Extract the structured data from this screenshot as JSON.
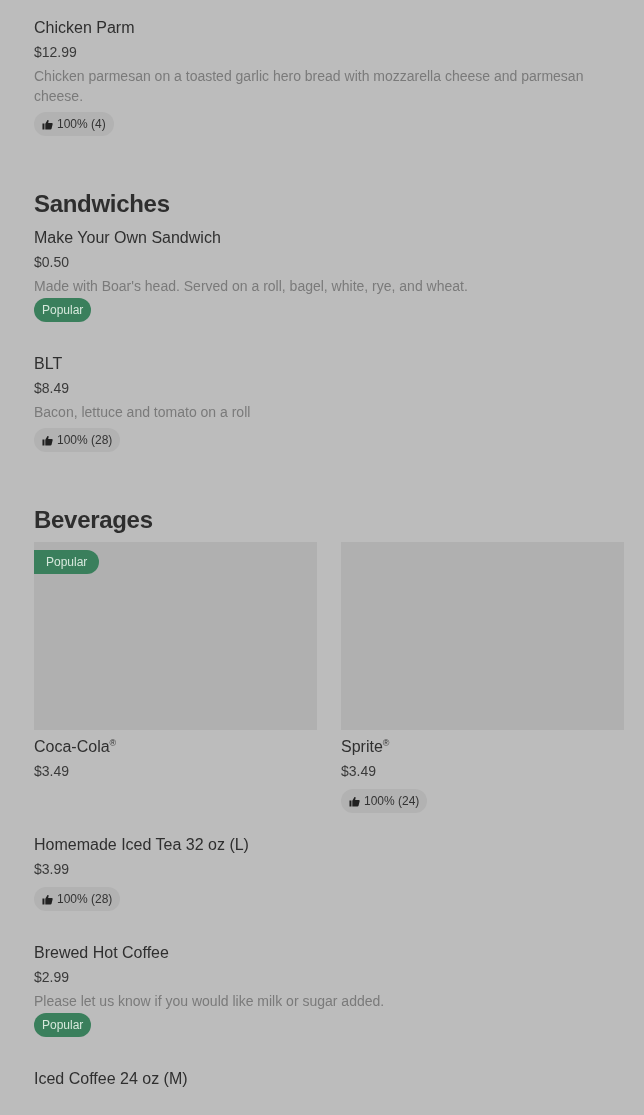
{
  "sections": [
    {
      "items": [
        {
          "name": "Chicken Parm",
          "price": "$12.99",
          "description": "Chicken parmesan on a toasted garlic hero bread with mozzarella cheese and parmesan cheese.",
          "badge": {
            "kind": "rating",
            "text": "100% (4)"
          }
        }
      ]
    },
    {
      "heading": "Sandwiches",
      "items": [
        {
          "name": "Make Your Own Sandwich",
          "price": "$0.50",
          "description": "Made with Boar's head. Served on a roll, bagel, white, rye, and wheat.",
          "badge": {
            "kind": "popular",
            "text": "Popular"
          }
        },
        {
          "name": "BLT",
          "price": "$8.49",
          "description": "Bacon, lettuce and tomato on a roll",
          "badge": {
            "kind": "rating",
            "text": "100% (28)"
          }
        }
      ]
    },
    {
      "heading": "Beverages",
      "cards": [
        {
          "name": "Coca-Cola$^{®}$",
          "price": "$3.49",
          "badge": {
            "kind": "popular",
            "text": "Popular"
          }
        },
        {
          "name": "Sprite$^{®}$",
          "price": "$3.49",
          "badge": {
            "kind": "rating",
            "text": "100% (24)"
          }
        }
      ],
      "items": [
        {
          "name": "Homemade Iced Tea 32 oz (L)",
          "price": "$3.99",
          "badge": {
            "kind": "rating",
            "text": "100% (28)"
          }
        },
        {
          "name": "Brewed Hot Coffee",
          "price": "$2.99",
          "description": "Please let us know if you would like milk or sugar added.",
          "badge": {
            "kind": "popular",
            "text": "Popular"
          }
        },
        {
          "name": "Iced Coffee 24 oz (M)"
        }
      ]
    }
  ]
}
